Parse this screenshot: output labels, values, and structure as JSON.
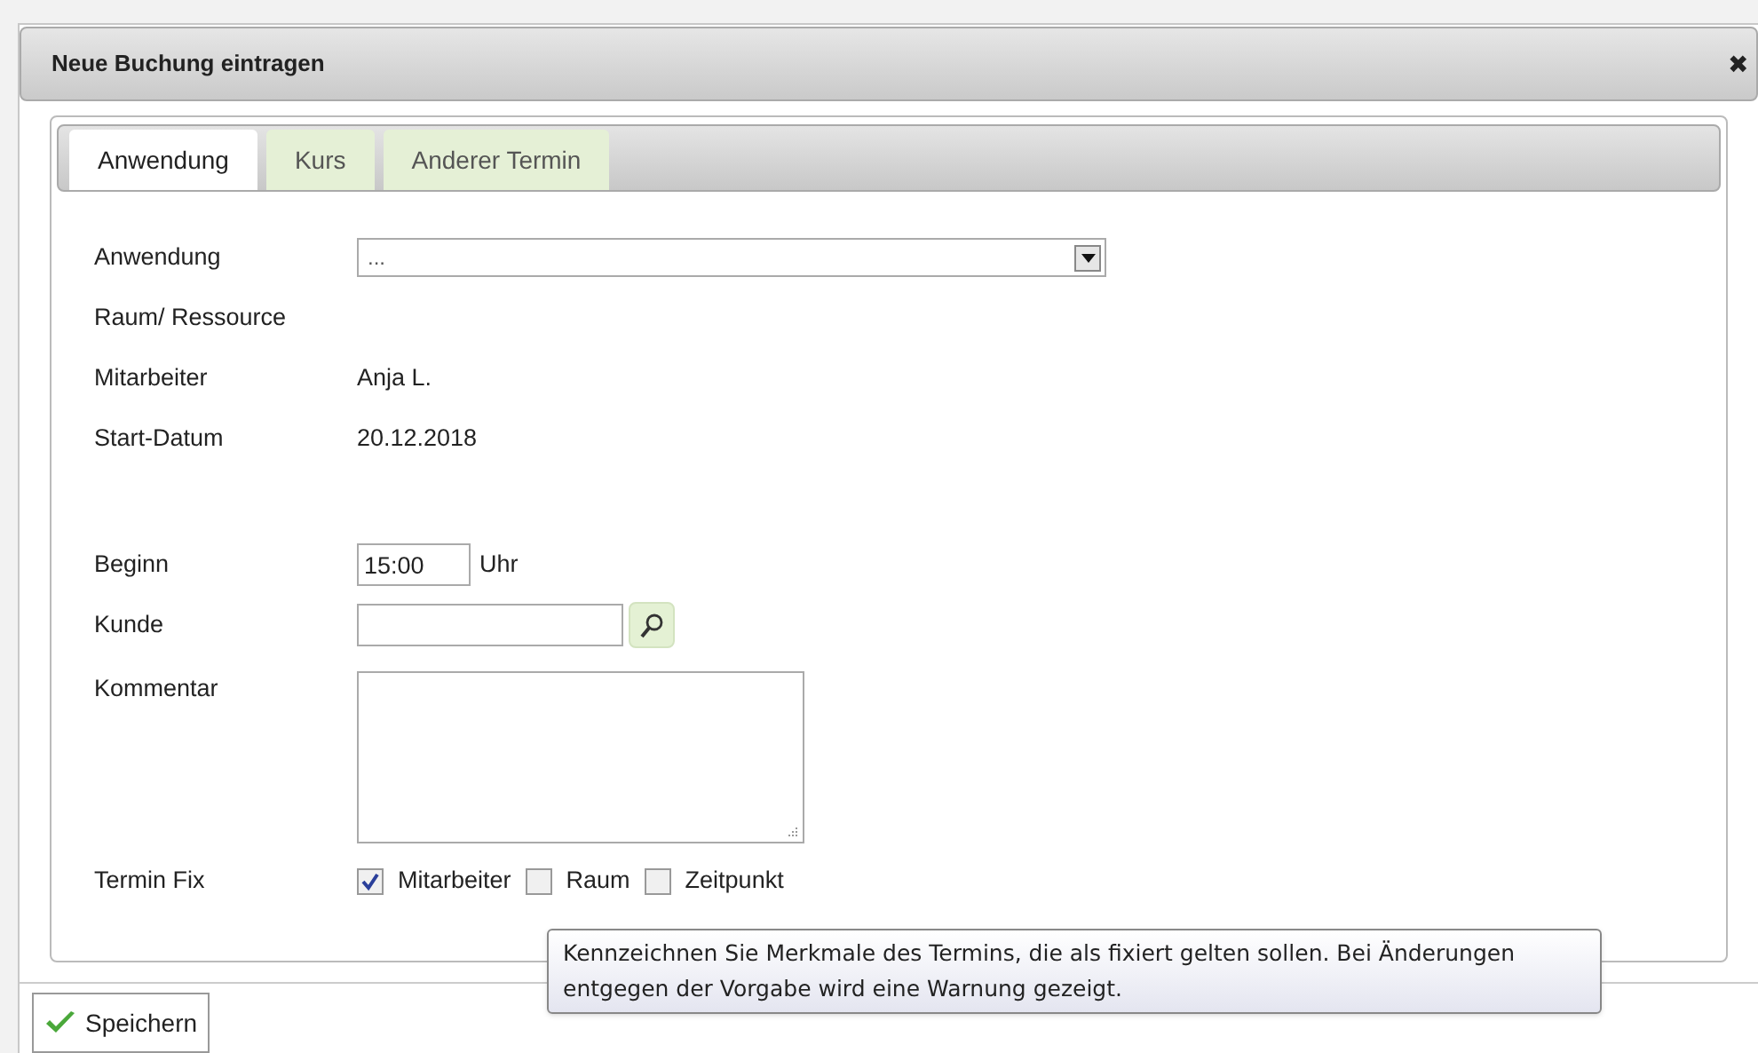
{
  "dialog": {
    "title": "Neue Buchung eintragen",
    "close": "✖"
  },
  "tabs": [
    {
      "label": "Anwendung",
      "selected": true
    },
    {
      "label": "Kurs",
      "selected": false
    },
    {
      "label": "Anderer Termin",
      "selected": false
    }
  ],
  "form": [
    {
      "kind": "select",
      "label": "Anwendung",
      "value": "..."
    },
    {
      "kind": "text",
      "label": "Raum/ Ressource"
    },
    {
      "kind": "text",
      "label": "Mitarbeiter",
      "value": "Anja L."
    },
    {
      "kind": "text",
      "label": "Start-Datum",
      "value": "20.12.2018"
    },
    {
      "kind": "time",
      "label": "Beginn",
      "value": "15:00",
      "unit": "Uhr"
    },
    {
      "kind": "search",
      "label": "Kunde"
    },
    {
      "kind": "textarea",
      "label": "Kommentar"
    },
    {
      "kind": "checkboxes",
      "label": "Termin Fix",
      "options": [
        {
          "label": "Mitarbeiter",
          "checked": true
        },
        {
          "label": "Raum",
          "checked": false
        },
        {
          "label": "Zeitpunkt",
          "checked": false
        }
      ]
    }
  ],
  "tooltip": "Kennzeichnen Sie Merkmale des Termins, die als fixiert gelten sollen. Bei Änderungen entgegen der Vorgabe wird eine Warnung gezeigt.",
  "save_button": "Speichern"
}
